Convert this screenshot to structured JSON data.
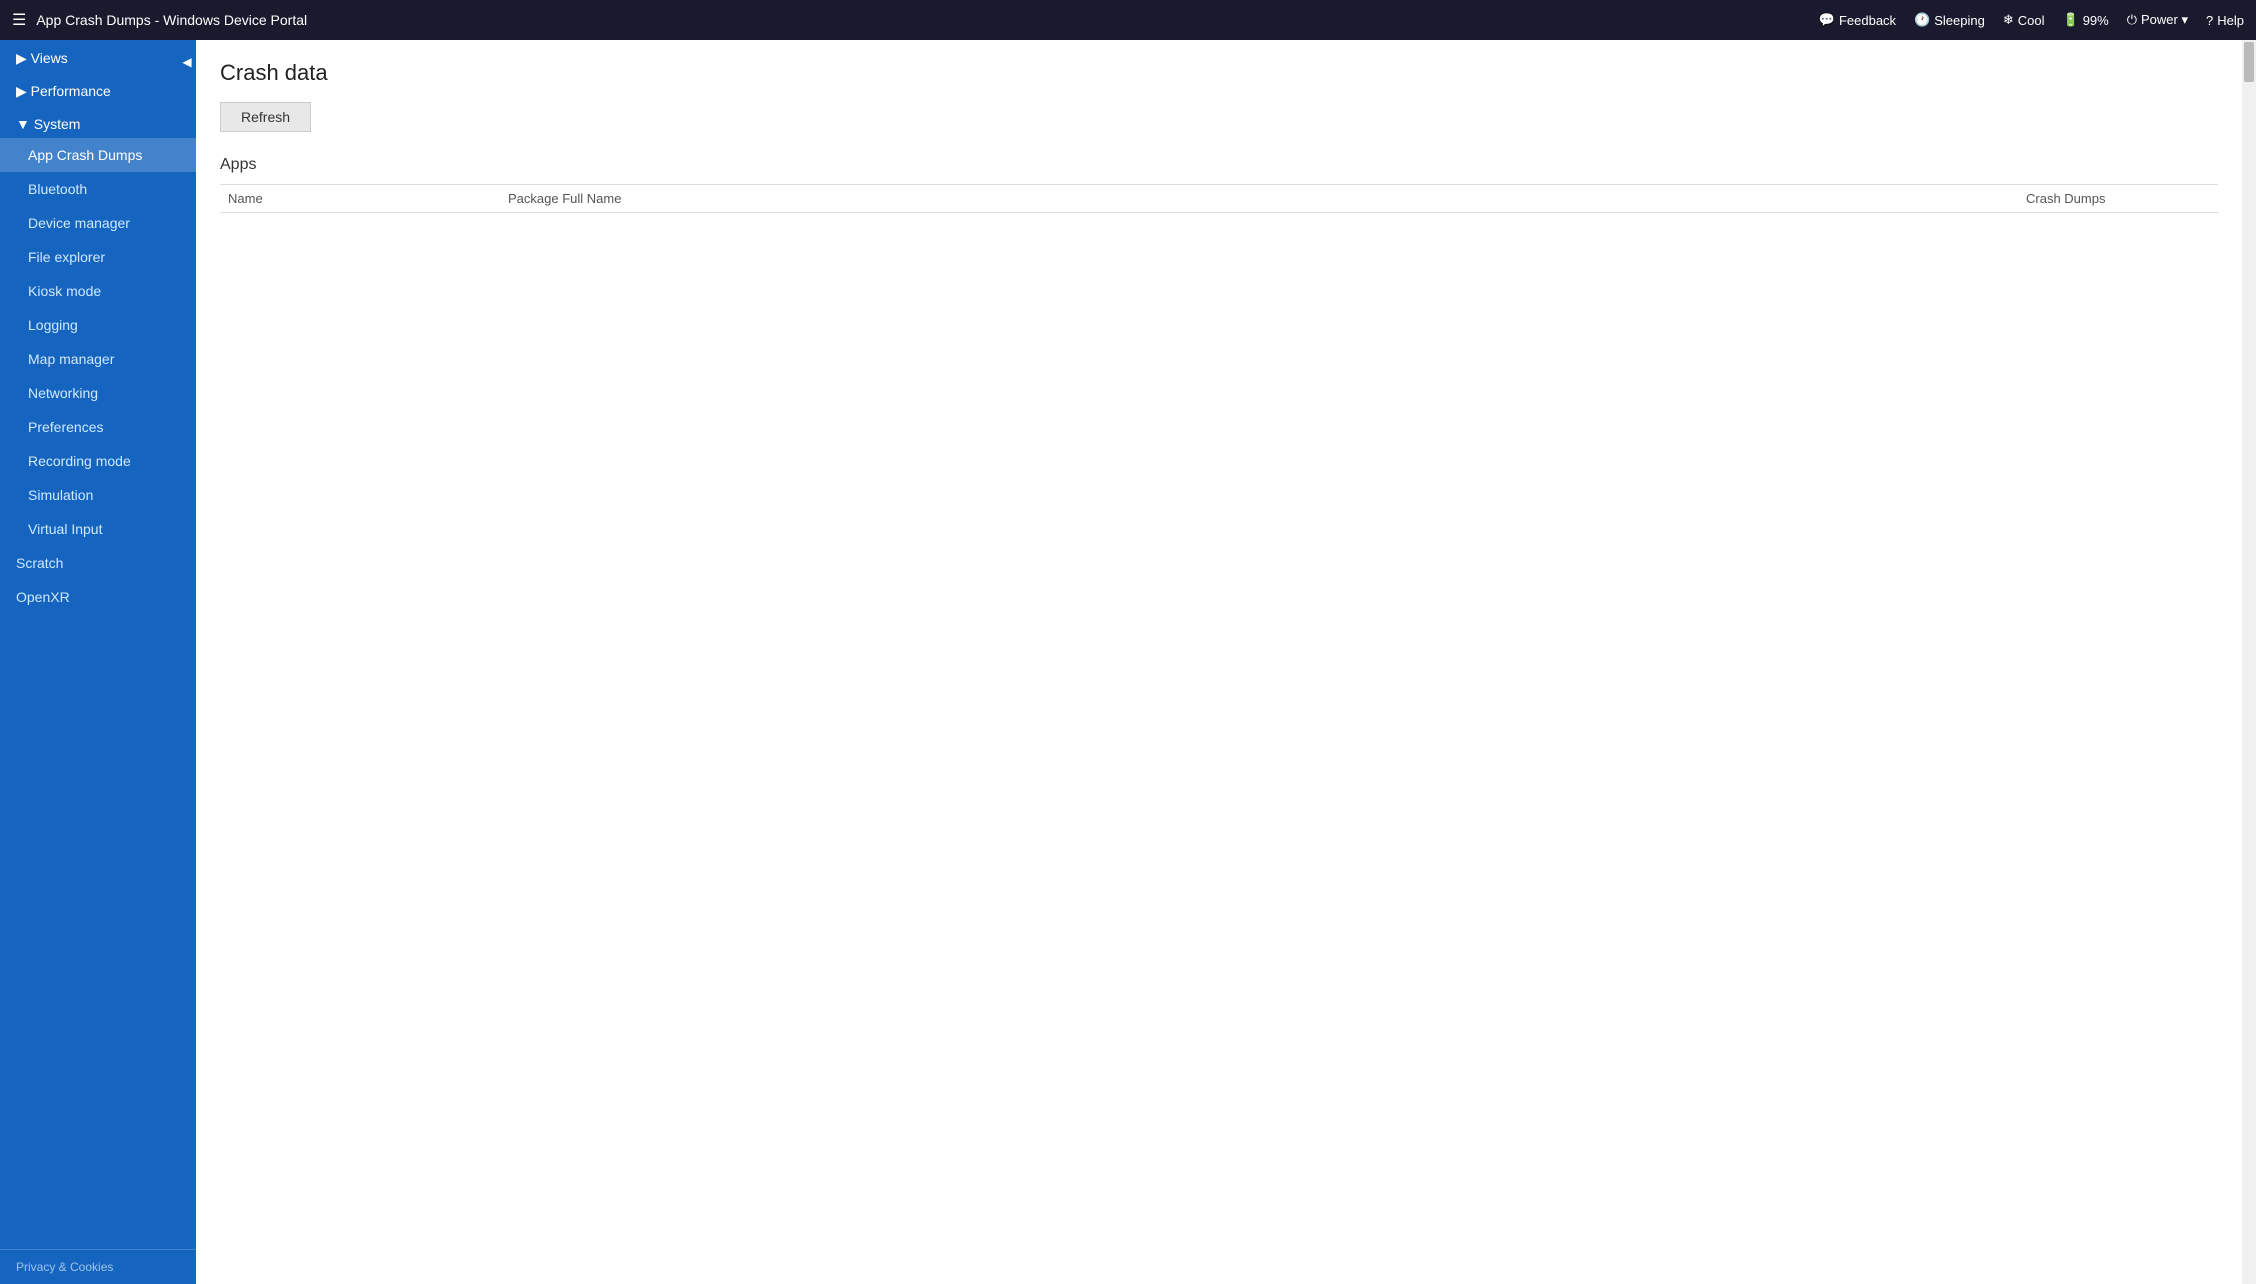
{
  "titlebar": {
    "icon": "☰",
    "title": "App Crash Dumps - Windows Device Portal",
    "items": [
      {
        "icon": "💬",
        "label": "Feedback"
      },
      {
        "icon": "🕐",
        "label": "Sleeping"
      },
      {
        "icon": "❄",
        "label": "Cool"
      },
      {
        "icon": "🔋",
        "label": "99%"
      },
      {
        "icon": "⏻",
        "label": "Power ▾"
      },
      {
        "icon": "?",
        "label": "Help"
      }
    ]
  },
  "sidebar": {
    "collapse_icon": "◀",
    "sections": [
      {
        "label": "▶ Views",
        "type": "header",
        "expanded": false,
        "items": []
      },
      {
        "label": "▶ Performance",
        "type": "header",
        "expanded": false,
        "items": []
      },
      {
        "label": "▼ System",
        "type": "header",
        "expanded": true,
        "items": [
          {
            "label": "App Crash Dumps",
            "active": true
          },
          {
            "label": "Bluetooth",
            "active": false
          },
          {
            "label": "Device manager",
            "active": false
          },
          {
            "label": "File explorer",
            "active": false
          },
          {
            "label": "Kiosk mode",
            "active": false
          },
          {
            "label": "Logging",
            "active": false
          },
          {
            "label": "Map manager",
            "active": false
          },
          {
            "label": "Networking",
            "active": false
          },
          {
            "label": "Preferences",
            "active": false
          },
          {
            "label": "Recording mode",
            "active": false
          },
          {
            "label": "Simulation",
            "active": false
          },
          {
            "label": "Virtual Input",
            "active": false
          }
        ]
      }
    ],
    "top_items": [
      {
        "label": "Scratch"
      },
      {
        "label": "OpenXR"
      }
    ],
    "footer": "Privacy & Cookies"
  },
  "content": {
    "title": "Crash data",
    "refresh_button": "Refresh",
    "section_title": "Apps",
    "table": {
      "columns": [
        {
          "label": "Name"
        },
        {
          "label": "Package Full Name"
        },
        {
          "label": "Crash Dumps"
        }
      ],
      "rows": []
    }
  }
}
